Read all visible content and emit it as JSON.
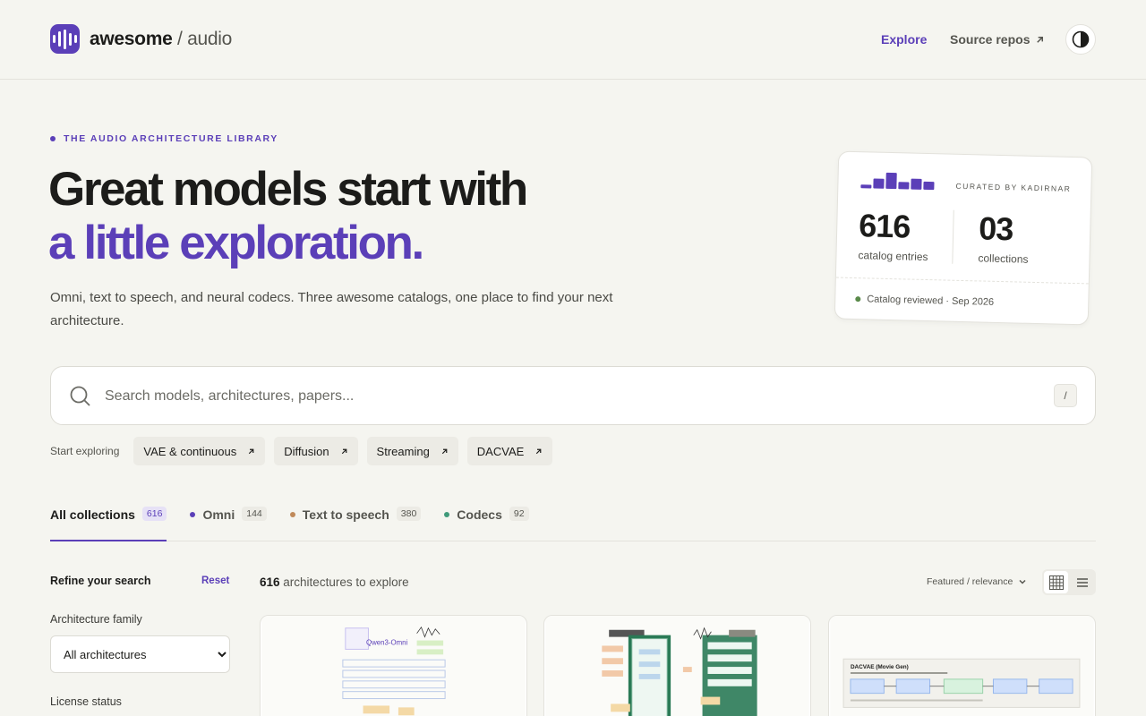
{
  "header": {
    "logo_brand": "awesome",
    "logo_suffix": "/ audio",
    "nav_explore": "Explore",
    "nav_repos": "Source repos",
    "theme_icon": "contrast-icon"
  },
  "hero": {
    "eyebrow": "THE AUDIO ARCHITECTURE LIBRARY",
    "title_line1": "Great models start with",
    "title_line2": "a little exploration.",
    "subtitle": "Omni, text to speech, and neural codecs. Three awesome catalogs, one place to find your next architecture."
  },
  "stats": {
    "curated": "CURATED BY KADIRNAR",
    "entries_value": "616",
    "entries_label": "catalog entries",
    "collections_value": "03",
    "collections_label": "collections",
    "footer": "Catalog reviewed · Sep 2026"
  },
  "search": {
    "placeholder": "Search models, architectures, papers...",
    "shortcut": "/"
  },
  "explore": {
    "label": "Start exploring",
    "chips": [
      "VAE & continuous",
      "Diffusion",
      "Streaming",
      "DACVAE"
    ]
  },
  "tabs": [
    {
      "label": "All collections",
      "count": "616"
    },
    {
      "label": "Omni",
      "count": "144",
      "color": "#5b3fb8"
    },
    {
      "label": "Text to speech",
      "count": "380",
      "color": "#c08a5a"
    },
    {
      "label": "Codecs",
      "count": "92",
      "color": "#3f9a7a"
    }
  ],
  "sidebar": {
    "title": "Refine your search",
    "reset": "Reset",
    "family_label": "Architecture family",
    "family_selected": "All architectures",
    "license_label": "License status"
  },
  "results": {
    "count": "616",
    "count_suffix": "architectures to explore",
    "sort": "Featured / relevance"
  },
  "cards": [
    {
      "thumb_title": "Qwen3-Omni"
    },
    {
      "thumb_title": ""
    },
    {
      "thumb_title": "DACVAE (Movie Gen)"
    }
  ],
  "colors": {
    "accent": "#5b3fb8",
    "background": "#f5f5f0"
  }
}
